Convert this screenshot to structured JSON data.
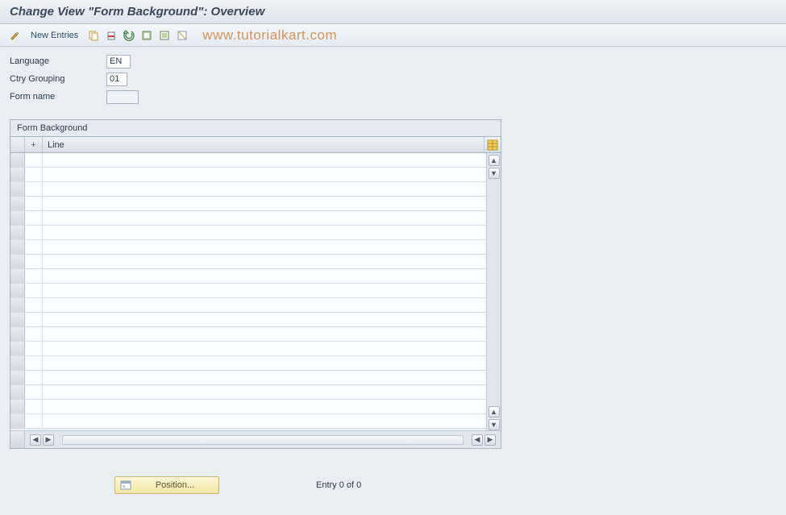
{
  "title": "Change View \"Form Background\": Overview",
  "toolbar": {
    "new_entries_label": "New Entries"
  },
  "watermark": "www.tutorialkart.com",
  "fields": {
    "language_label": "Language",
    "language_value": "EN",
    "ctry_grouping_label": "Ctry Grouping",
    "ctry_grouping_value": "01",
    "form_name_label": "Form name",
    "form_name_value": ""
  },
  "panel": {
    "title": "Form Background",
    "columns": {
      "plus": "+",
      "line": "Line"
    },
    "row_count": 19
  },
  "footer": {
    "position_label": "Position...",
    "entry_status": "Entry 0 of 0"
  }
}
